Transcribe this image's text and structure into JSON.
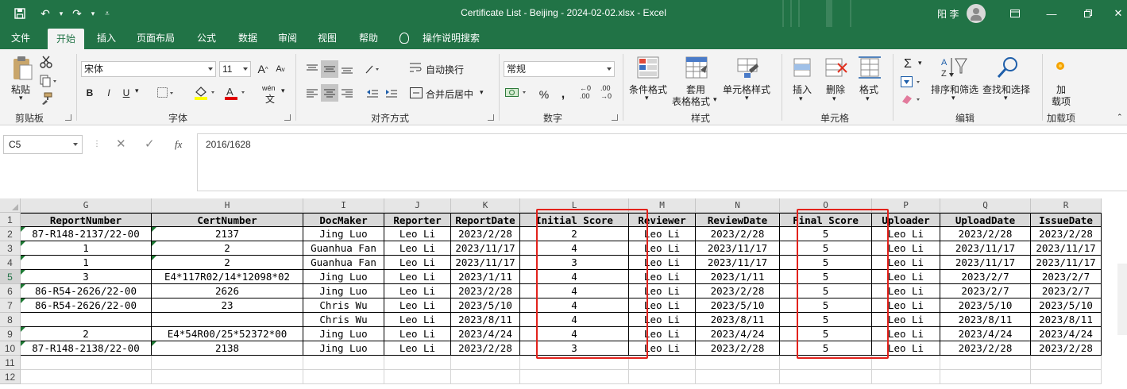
{
  "window": {
    "title": "Certificate List - Beijing - 2024-02-02.xlsx  -  Excel",
    "user_name": "阳 李"
  },
  "tabs": [
    "文件",
    "开始",
    "插入",
    "页面布局",
    "公式",
    "数据",
    "审阅",
    "视图",
    "帮助"
  ],
  "tell_me": "操作说明搜索",
  "ribbon": {
    "clipboard": {
      "paste": "粘贴",
      "label": "剪贴板"
    },
    "font": {
      "name": "宋体",
      "size": "11",
      "grow": "A",
      "shrink": "A",
      "bold": "B",
      "italic": "I",
      "underline": "U",
      "phonetic": "wén",
      "label": "字体"
    },
    "alignment": {
      "wrap": "自动换行",
      "merge": "合并后居中",
      "label": "对齐方式"
    },
    "number": {
      "format": "常规",
      "percent": "%",
      "comma": ",",
      "inc_dec": ".00",
      "dec_dec": ".00",
      "label": "数字"
    },
    "styles": {
      "conditional": "条件格式",
      "table_line1": "套用",
      "table_line2": "表格格式",
      "cell_styles": "单元格样式",
      "label": "样式"
    },
    "cells": {
      "insert": "插入",
      "delete": "删除",
      "format": "格式",
      "label": "单元格"
    },
    "editing": {
      "sort": "排序和筛选",
      "find": "查找和选择",
      "label": "编辑"
    },
    "addins": {
      "line1": "加",
      "line2": "载项",
      "label": "加载项"
    }
  },
  "formula_bar": {
    "name_box": "C5",
    "fx": "fx",
    "value": "2016/1628"
  },
  "sheet": {
    "columns": [
      "G",
      "H",
      "I",
      "J",
      "K",
      "L",
      "M",
      "N",
      "O",
      "P",
      "Q",
      "R"
    ],
    "row_numbers": [
      "1",
      "2",
      "3",
      "4",
      "5",
      "6",
      "7",
      "8",
      "9",
      "10",
      "11",
      "12"
    ],
    "selected_row": "5",
    "headers": [
      "ReportNumber",
      "CertNumber",
      "DocMaker",
      "Reporter",
      "ReportDate",
      "Initial Score",
      "Reviewer",
      "ReviewDate",
      "Final Score",
      "Uploader",
      "UploadDate",
      "IssueDate"
    ],
    "rows": [
      [
        "87-R148-2137/22-00",
        "2137",
        "Jing Luo",
        "Leo Li",
        "2023/2/28",
        "2",
        "Leo Li",
        "2023/2/28",
        "5",
        "Leo Li",
        "2023/2/28",
        "2023/2/28"
      ],
      [
        "1",
        "2",
        "Guanhua Fan",
        "Leo Li",
        "2023/11/17",
        "4",
        "Leo Li",
        "2023/11/17",
        "5",
        "Leo Li",
        "2023/11/17",
        "2023/11/17"
      ],
      [
        "1",
        "2",
        "Guanhua Fan",
        "Leo Li",
        "2023/11/17",
        "3",
        "Leo Li",
        "2023/11/17",
        "5",
        "Leo Li",
        "2023/11/17",
        "2023/11/17"
      ],
      [
        "3",
        "E4*117R02/14*12098*02",
        "Jing Luo",
        "Leo Li",
        "2023/1/11",
        "4",
        "Leo Li",
        "2023/1/11",
        "5",
        "Leo Li",
        "2023/2/7",
        "2023/2/7"
      ],
      [
        "86-R54-2626/22-00",
        "2626",
        "Jing Luo",
        "Leo Li",
        "2023/2/28",
        "4",
        "Leo Li",
        "2023/2/28",
        "5",
        "Leo Li",
        "2023/2/7",
        "2023/2/7"
      ],
      [
        "86-R54-2626/22-00",
        "23",
        "Chris Wu",
        "Leo Li",
        "2023/5/10",
        "4",
        "Leo Li",
        "2023/5/10",
        "5",
        "Leo Li",
        "2023/5/10",
        "2023/5/10"
      ],
      [
        "",
        "",
        "Chris Wu",
        "Leo Li",
        "2023/8/11",
        "4",
        "Leo Li",
        "2023/8/11",
        "5",
        "Leo Li",
        "2023/8/11",
        "2023/8/11"
      ],
      [
        "2",
        "E4*54R00/25*52372*00",
        "Jing Luo",
        "Leo Li",
        "2023/4/24",
        "4",
        "Leo Li",
        "2023/4/24",
        "5",
        "Leo Li",
        "2023/4/24",
        "2023/4/24"
      ],
      [
        "87-R148-2138/22-00",
        "2138",
        "Jing Luo",
        "Leo Li",
        "2023/2/28",
        "3",
        "Leo Li",
        "2023/2/28",
        "5",
        "Leo Li",
        "2023/2/28",
        "2023/2/28"
      ]
    ],
    "error_marker_cells": [
      [
        0,
        0
      ],
      [
        0,
        1
      ],
      [
        1,
        0
      ],
      [
        1,
        1
      ],
      [
        2,
        0
      ],
      [
        2,
        1
      ],
      [
        3,
        0
      ],
      [
        4,
        0
      ],
      [
        5,
        0
      ],
      [
        7,
        0
      ],
      [
        8,
        0
      ],
      [
        8,
        1
      ]
    ],
    "highlighted_columns": [
      "L",
      "O"
    ],
    "highlight_color": "#e2221c",
    "accent_color": "#217346"
  }
}
